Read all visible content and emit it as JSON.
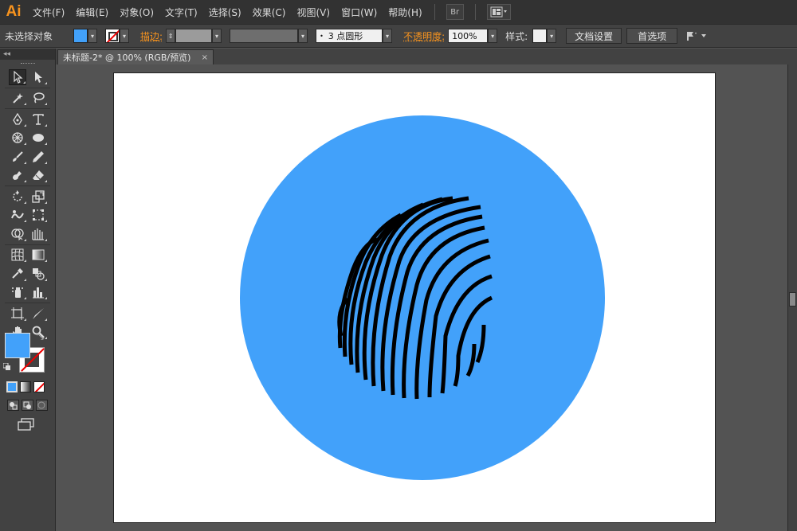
{
  "app": {
    "logo": "Ai"
  },
  "menus": [
    "文件(F)",
    "编辑(E)",
    "对象(O)",
    "文字(T)",
    "选择(S)",
    "效果(C)",
    "视图(V)",
    "窗口(W)",
    "帮助(H)"
  ],
  "menubar_buttons": {
    "bridge": "Br"
  },
  "control_bar": {
    "selection_label": "未选择对象",
    "fill_color": "#42a1fa",
    "stroke_label": "描边:",
    "brush_value": "3 点圆形",
    "opacity_label": "不透明度:",
    "opacity_value": "100%",
    "style_label": "样式:",
    "doc_setup_button": "文档设置",
    "preferences_button": "首选项"
  },
  "document_tab": {
    "title": "未标题-2* @ 100% (RGB/预览)",
    "close": "×"
  },
  "tools": [
    [
      "selection-tool",
      "direct-selection-tool"
    ],
    [
      "magic-wand-tool",
      "lasso-tool"
    ],
    [
      "pen-tool",
      "type-tool"
    ],
    [
      "line-tool",
      "ellipse-tool"
    ],
    [
      "paintbrush-tool",
      "pencil-tool"
    ],
    [
      "blob-brush-tool",
      "eraser-tool"
    ],
    [
      "rotate-tool",
      "scale-tool"
    ],
    [
      "warp-tool",
      "free-transform-tool"
    ],
    [
      "shape-builder-tool",
      "perspective-grid-tool"
    ],
    [
      "mesh-tool",
      "gradient-tool"
    ],
    [
      "eyedropper-tool",
      "blend-tool"
    ],
    [
      "symbol-sprayer-tool",
      "column-graph-tool"
    ],
    [
      "artboard-tool",
      "slice-tool"
    ],
    [
      "hand-tool",
      "zoom-tool"
    ]
  ],
  "colors": {
    "fill": "#42a1fa",
    "circle": "#42a1fa",
    "fingerprint": "#000000",
    "accent": "#f7931e"
  }
}
